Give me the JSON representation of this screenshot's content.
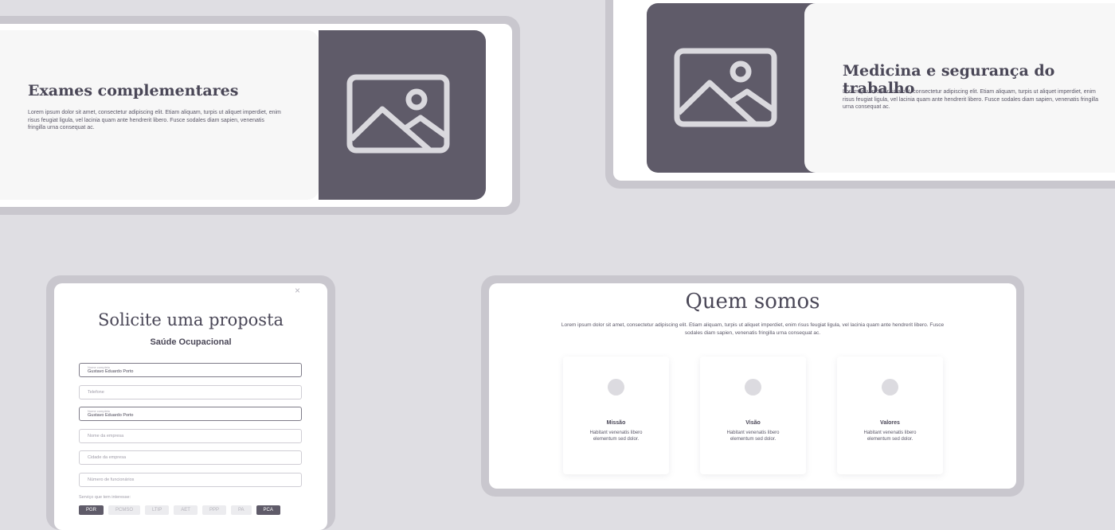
{
  "card_exames": {
    "title": "Exames complementares",
    "body": "Lorem ipsum dolor sit amet, consectetur adipiscing elit. Etiam aliquam, turpis ut aliquet imperdiet, enim risus feugiat ligula, vel lacinia quam ante hendrerit libero. Fusce sodales diam sapien, venenatis fringilla urna consequat ac.",
    "image_icon": "image-placeholder-icon"
  },
  "card_medicina": {
    "title": "Medicina e segurança do trabalho",
    "body": "Lorem ipsum dolor sit amet, consectetur adipiscing elit. Etiam aliquam, turpis ut aliquet imperdiet, enim risus feugiat ligula, vel lacinia quam ante hendrerit libero. Fusce sodales diam sapien, venenatis fringilla urna consequat ac.",
    "image_icon": "image-placeholder-icon"
  },
  "form": {
    "close": "×",
    "title": "Solicite uma proposta",
    "subtitle": "Saúde Ocupacional",
    "fields": [
      {
        "label": "Nome completo",
        "value": "Gustavo Eduardo Porto"
      },
      {
        "placeholder": "Telefone"
      },
      {
        "label": "Nome completo",
        "value": "Gustavo Eduardo Porto"
      },
      {
        "placeholder": "Nome da empresa"
      },
      {
        "placeholder": "Cidade da empresa"
      },
      {
        "placeholder": "Número de funcionários"
      }
    ],
    "services_label": "Serviço que tem interesse:",
    "services": [
      "PGR",
      "PCMSO",
      "LTIP",
      "AET",
      "PPP",
      "PA",
      "PCA"
    ]
  },
  "about": {
    "title": "Quem somos",
    "body": "Lorem ipsum dolor sit amet, consectetur adipiscing elit. Etiam aliquam, turpis ut aliquet imperdiet, enim risus feugiat ligula, vel lacinia quam ante hendrerit libero. Fusce sodales diam sapien, venenatis fringilla urna consequat ac.",
    "values": [
      {
        "title": "Missão",
        "desc": "Habitant venenatis libero elementum sed dolor."
      },
      {
        "title": "Visão",
        "desc": "Habitant venenatis libero elementum sed dolor."
      },
      {
        "title": "Valores",
        "desc": "Habitant venenatis libero elementum sed dolor."
      }
    ]
  },
  "colors": {
    "background": "#dfdee3",
    "frame": "#c9c7ce",
    "accent_dark": "#5f5b69",
    "text_dark": "#4a4757"
  }
}
